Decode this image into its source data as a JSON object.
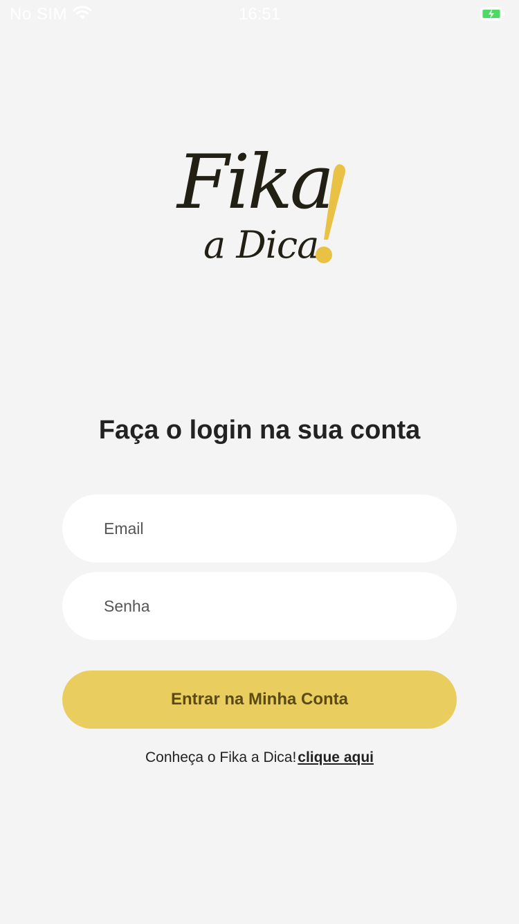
{
  "status_bar": {
    "carrier": "No SIM",
    "time": "16:51",
    "icons": [
      "wifi-icon",
      "battery-charging-icon"
    ]
  },
  "logo": {
    "line1": "Fika",
    "line2": "a Dica",
    "mark": "!",
    "colors": {
      "text": "#221f15",
      "accent": "#e9c144"
    }
  },
  "heading": {
    "prefix": "Faça o ",
    "emphasis": "login",
    "suffix": " na sua conta"
  },
  "form": {
    "email_placeholder": "Email",
    "password_placeholder": "Senha",
    "submit_label": "Entrar na Minha Conta"
  },
  "footer": {
    "text": "Conheça o Fika a Dica!",
    "link_label": "clique aqui"
  },
  "colors": {
    "background": "#f4f4f4",
    "button": "#e9cd5f",
    "button_text": "#5c4a12"
  }
}
